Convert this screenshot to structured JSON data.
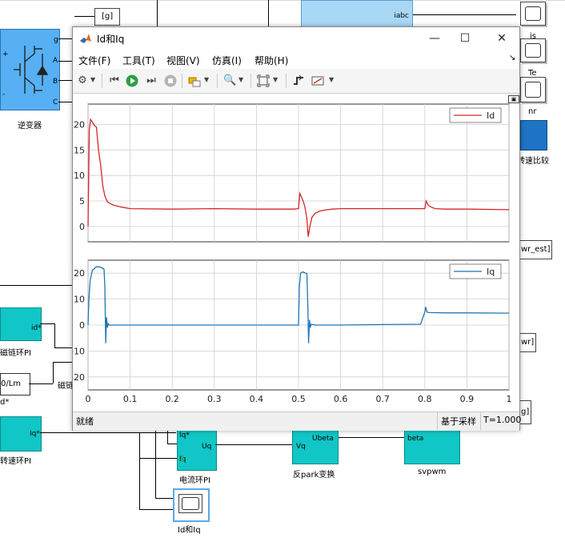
{
  "background": {
    "inverter_label": "逆变器",
    "inverter_ports": [
      "g",
      "A",
      "B",
      "C"
    ],
    "inverter_plus": "+",
    "inverter_minus": "-",
    "goto_g": "[g]",
    "iabc_label": "iabc",
    "is_label": "is",
    "te_label": "Te",
    "nr_label": "nr",
    "speed_compare": "转速比较",
    "wr_est_tag": "wr_est]",
    "wr_tag": "wr]",
    "g_tag": "g]",
    "flux_pi_label": "磁链环PI",
    "flux_pi_port": "id*",
    "lm_block": "0/Lm",
    "d_star": "d*",
    "flux_small": "磁链",
    "speed_pi_label": "转速环PI",
    "speed_pi_port": "Iq*",
    "current_pi_label": "电流环PI",
    "current_pi_ports": [
      "Iq*",
      "Uq",
      "Iq"
    ],
    "inv_park_label": "反park变换",
    "inv_park_ports": [
      "Vq",
      "Ubeta"
    ],
    "svpwm_label": "svpwm",
    "svpwm_port": "beta",
    "scope_label": "Id和Iq"
  },
  "window": {
    "title": "Id和Iq",
    "minimize": "—",
    "maximize": "☐",
    "close": "✕",
    "menu": [
      "文件(F)",
      "工具(T)",
      "视图(V)",
      "仿真(I)",
      "帮助(H)"
    ],
    "menu_pin": "↘",
    "status_left": "就绪",
    "status_sampling": "基于采样",
    "status_time": "T=1.000"
  },
  "chart_data": [
    {
      "type": "line",
      "title": "",
      "xlabel": "",
      "ylabel": "",
      "xlim": [
        0,
        1
      ],
      "ylim": [
        -3,
        24
      ],
      "xticks": [
        0,
        0.1,
        0.2,
        0.3,
        0.4,
        0.5,
        0.6,
        0.7,
        0.8,
        0.9,
        1
      ],
      "yticks": [
        0,
        5,
        10,
        15,
        20
      ],
      "grid": true,
      "legend": "top-right",
      "series": [
        {
          "name": "Id",
          "color": "#d62728",
          "x": [
            0,
            0.003,
            0.006,
            0.01,
            0.015,
            0.02,
            0.025,
            0.03,
            0.035,
            0.04,
            0.045,
            0.05,
            0.06,
            0.08,
            0.1,
            0.2,
            0.3,
            0.4,
            0.49,
            0.5,
            0.503,
            0.508,
            0.512,
            0.516,
            0.52,
            0.523,
            0.527,
            0.532,
            0.54,
            0.55,
            0.56,
            0.58,
            0.6,
            0.7,
            0.79,
            0.8,
            0.803,
            0.808,
            0.815,
            0.825,
            0.85,
            0.9,
            1
          ],
          "y": [
            0,
            19,
            21,
            20.5,
            19.8,
            19.5,
            15,
            12,
            8,
            6,
            5,
            4.6,
            4.2,
            3.8,
            3.5,
            3.4,
            3.5,
            3.4,
            3.4,
            3.5,
            6.5,
            5.6,
            4.8,
            3.5,
            1.5,
            -2,
            0,
            1.8,
            2.6,
            3.0,
            3.2,
            3.4,
            3.5,
            3.5,
            3.5,
            3.5,
            5,
            4.2,
            3.8,
            3.5,
            3.4,
            3.4,
            3.3
          ]
        }
      ]
    },
    {
      "type": "line",
      "title": "",
      "xlabel": "",
      "ylabel": "",
      "xlim": [
        0,
        1
      ],
      "ylim": [
        -25,
        25
      ],
      "xticks": [
        0,
        0.1,
        0.2,
        0.3,
        0.4,
        0.5,
        0.6,
        0.7,
        0.8,
        0.9,
        1
      ],
      "yticks": [
        -20,
        -10,
        0,
        10,
        20
      ],
      "grid": true,
      "legend": "top-right",
      "series": [
        {
          "name": "Iq",
          "color": "#1f77b4",
          "x": [
            0,
            0.002,
            0.005,
            0.01,
            0.02,
            0.03,
            0.038,
            0.04,
            0.042,
            0.044,
            0.046,
            0.048,
            0.05,
            0.1,
            0.2,
            0.3,
            0.4,
            0.5,
            0.502,
            0.505,
            0.51,
            0.52,
            0.522,
            0.524,
            0.526,
            0.528,
            0.53,
            0.54,
            0.6,
            0.7,
            0.79,
            0.8,
            0.802,
            0.805,
            0.81,
            0.85,
            0.9,
            1
          ],
          "y": [
            0,
            10,
            17,
            21,
            22.5,
            22.3,
            21.5,
            15,
            -7,
            3,
            -1,
            0.5,
            0,
            0,
            0,
            0,
            0,
            0,
            15,
            20,
            20.5,
            19.8,
            8,
            -7,
            2,
            -1,
            0.3,
            0,
            0,
            0.2,
            0.3,
            5,
            7,
            5,
            4.8,
            4.7,
            4.7,
            4.6
          ]
        }
      ]
    }
  ]
}
